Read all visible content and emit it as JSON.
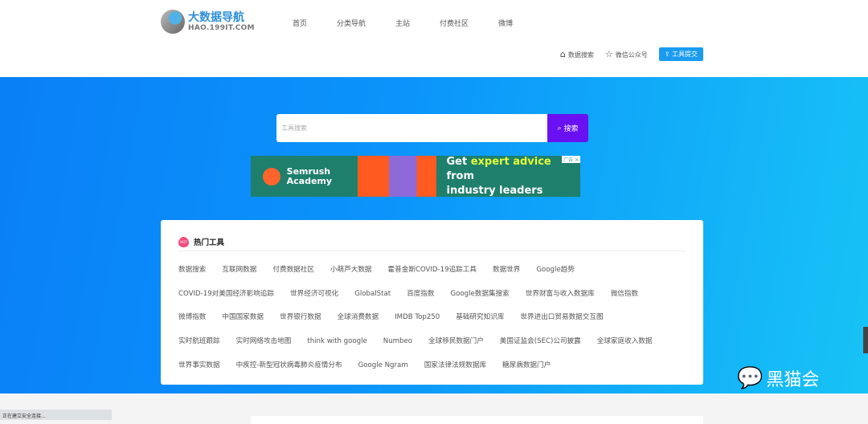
{
  "header": {
    "logo_title": "大数据导航",
    "logo_sub": "HAO.199IT.COM",
    "nav": [
      "首页",
      "分类导航",
      "主站",
      "付费社区",
      "微博"
    ],
    "tools": {
      "data_search": "数据搜索",
      "wechat": "微信公众号",
      "submit": "工具提交"
    }
  },
  "search": {
    "placeholder": "工具搜索",
    "button": "搜索"
  },
  "ad": {
    "brand": "Semrush Academy",
    "line1_a": "Get ",
    "line1_hl": "expert advice",
    "line1_b": " from",
    "line2": "industry leaders",
    "badge": "广告 ✕"
  },
  "hot": {
    "badge": "HOT",
    "title": "热门工具",
    "tags": [
      "数据搜索",
      "互联网数据",
      "付费数据社区",
      "小萌芦大数据",
      "霍普金斯COVID-19追踪工具",
      "数据世界",
      "Google趋势",
      "COVID-19对美国经济影响追踪",
      "世界经济可视化",
      "GlobalStat",
      "百度指数",
      "Google数据集搜索",
      "世界财富与收入数据库",
      "微信指数",
      "微博指数",
      "中国国家数据",
      "世界银行数据",
      "全球消费数据",
      "IMDB Top250",
      "基础研究知识库",
      "世界进出口贸易数据交互图",
      "实时航班跟踪",
      "实时网络攻击地图",
      "think with google",
      "Numbeo",
      "全球移民数据门户",
      "美国证监会(SEC)公司披露",
      "全球家庭收入数据",
      "世界事实数据",
      "中疾控-新型冠状病毒肺炎疫情分布",
      "Google Ngram",
      "国家法律法规数据库",
      "糖尿病数据门户"
    ]
  },
  "watermark": "黑猫会",
  "status": "正在建立安全连接..."
}
